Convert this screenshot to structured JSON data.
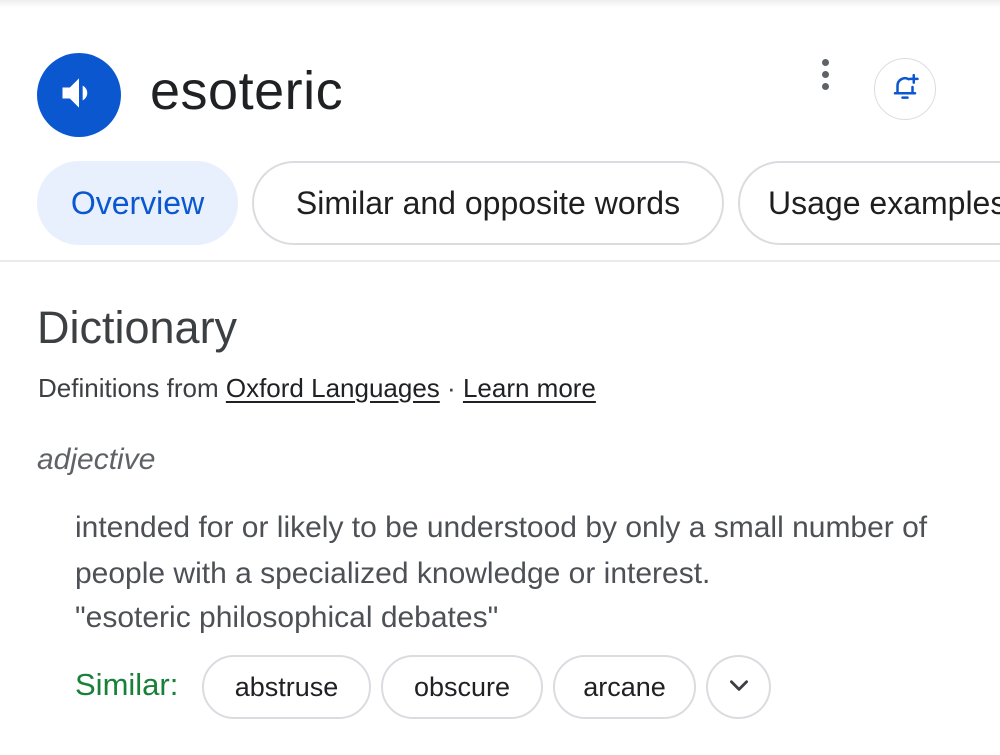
{
  "header": {
    "word": "esoteric",
    "speaker_icon": "volume-icon",
    "more_icon": "more-vert-icon",
    "alert_icon": "bell-plus-icon"
  },
  "tabs": [
    {
      "label": "Overview",
      "active": true
    },
    {
      "label": "Similar and opposite words",
      "active": false
    },
    {
      "label": "Usage examples",
      "active": false
    }
  ],
  "dictionary": {
    "title": "Dictionary",
    "source_prefix": "Definitions from",
    "source_link": "Oxford Languages",
    "separator": "·",
    "learn_more": "Learn more",
    "part_of_speech": "adjective",
    "definition": "intended for or likely to be understood by only a small number of people with a specialized knowledge or interest.",
    "example": "\"esoteric philosophical debates\"",
    "similar_label": "Similar:",
    "similar_words": [
      "abstruse",
      "obscure",
      "arcane"
    ],
    "expand_icon": "chevron-down-icon"
  },
  "colors": {
    "accent_blue": "#0b57d0",
    "active_tab_bg": "#e8f0fe",
    "similar_green": "#188038"
  }
}
